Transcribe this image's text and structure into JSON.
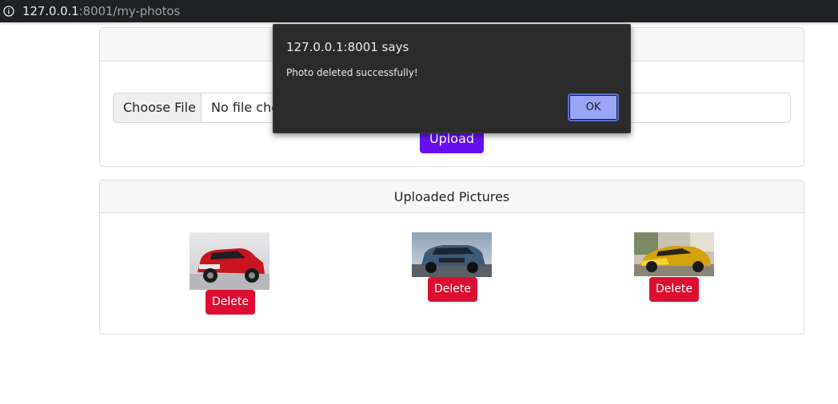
{
  "browser": {
    "url_host": "127.0.0.1",
    "url_rest": ":8001/my-photos",
    "info_icon": "info-icon"
  },
  "upload_card": {
    "header": "",
    "choose_file_label": "Choose File",
    "file_status": "No file chosen",
    "upload_label": "Upload"
  },
  "pictures_card": {
    "header": "Uploaded Pictures",
    "pictures": [
      {
        "alt": "red car",
        "delete_label": "Delete"
      },
      {
        "alt": "blue suv",
        "delete_label": "Delete"
      },
      {
        "alt": "gold sports car",
        "delete_label": "Delete"
      }
    ]
  },
  "dialog": {
    "title": "127.0.0.1:8001 says",
    "message": "Photo deleted successfully!",
    "ok_label": "OK"
  },
  "colors": {
    "upload_button": "#6610f2",
    "delete_button": "#dc0f32",
    "dialog_bg": "#2b2b2b",
    "ok_button": "#9aa5f5"
  }
}
